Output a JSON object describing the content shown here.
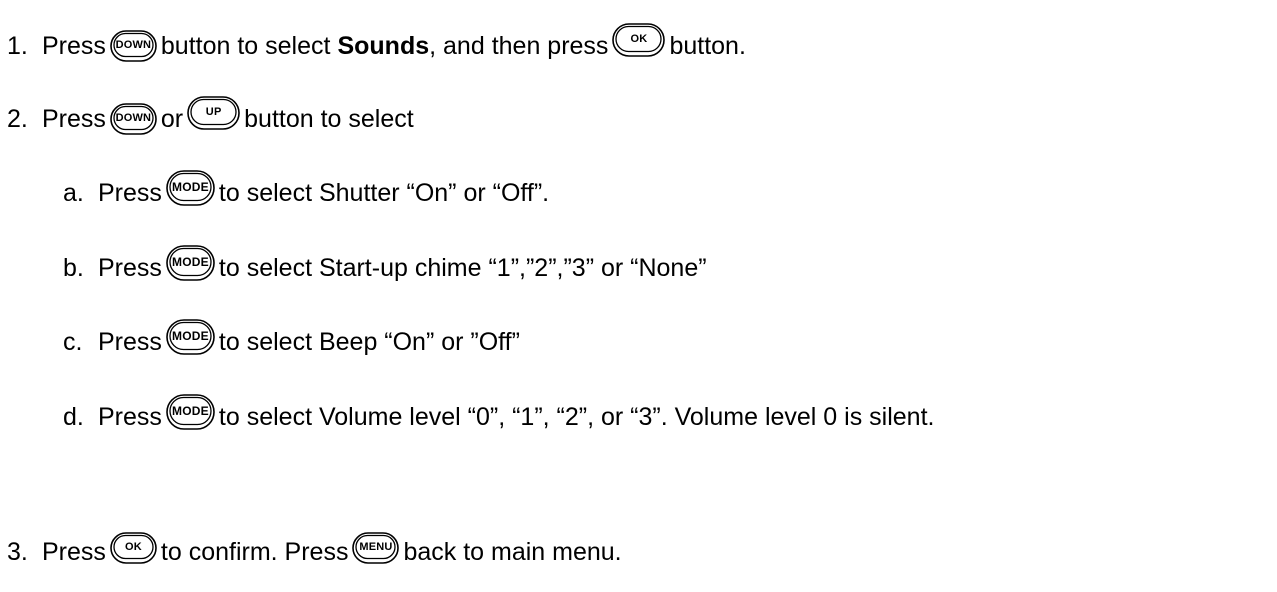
{
  "steps": [
    {
      "number": "1.",
      "press": "Press",
      "button1": "DOWN",
      "mid1": "button to select",
      "bold": "Sounds",
      "mid2": ", and then press",
      "button2": "OK",
      "end": "button."
    },
    {
      "number": "2.",
      "press": "Press",
      "button1": "DOWN",
      "or": "or",
      "button2": "UP",
      "end": "button to select"
    },
    {
      "number": "3.",
      "press": "Press",
      "button1": "OK",
      "mid": "to confirm. Press",
      "button2": "MENU",
      "end": "back to main menu."
    }
  ],
  "substeps": [
    {
      "letter": "a.",
      "press": "Press",
      "button": "MODE",
      "text": "to select Shutter “On” or “Off”."
    },
    {
      "letter": "b.",
      "press": "Press",
      "button": "MODE",
      "text": "to select Start-up chime “1”,”2”,”3” or “None”"
    },
    {
      "letter": "c.",
      "press": "Press",
      "button": "MODE",
      "text": "to select Beep “On” or ”Off”"
    },
    {
      "letter": "d.",
      "press": "Press",
      "button": "MODE",
      "text": "to select Volume level “0”, “1”, “2”, or “3”. Volume level 0 is silent."
    }
  ]
}
